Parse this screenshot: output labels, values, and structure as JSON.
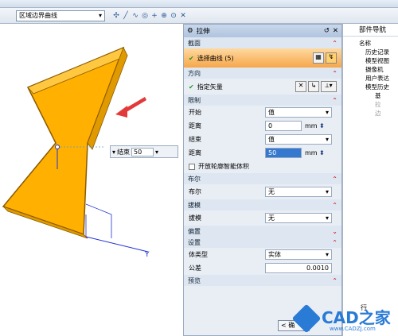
{
  "toolbar": {
    "filter_value": "区域边界曲线"
  },
  "viewport": {
    "float_end_label": "结束",
    "float_end_value": "50",
    "axis_y": "Y",
    "colors": {
      "shape": "#ffb000",
      "shape_edge": "#8a5a00",
      "arrow": "#e23a3a",
      "axis": "#2033d6"
    }
  },
  "dialog": {
    "title": "拉伸",
    "sections": {
      "section": "截面",
      "direction": "方向",
      "limits": "限制",
      "boolean": "布尔",
      "draft": "拔模",
      "offset": "偏置",
      "settings": "设置",
      "preview": "预览"
    },
    "select_curve": "选择曲线 (5)",
    "specify_vector": "指定矢量",
    "start_label": "开始",
    "start_type": "值",
    "start_dist_label": "距离",
    "start_dist_value": "0",
    "end_label": "结束",
    "end_type": "值",
    "end_dist_label": "距离",
    "end_dist_value": "50",
    "unit": "mm",
    "open_profile_label": "开放轮廓智能体积",
    "boolean_label": "布尔",
    "boolean_value": "无",
    "draft_label": "拔模",
    "draft_value": "无",
    "body_type_label": "体类型",
    "body_type_value": "实体",
    "tolerance_label": "公差",
    "tolerance_value": "0.0010",
    "ok_button": "< 确"
  },
  "navigator": {
    "title": "部件导航",
    "items": [
      "名称",
      "历史记录",
      "模型视图",
      "摄像机",
      "用户表达",
      "模型历史",
      "基",
      "拉",
      "边",
      "行"
    ]
  },
  "watermark": {
    "brand": "CAD之家",
    "url": "www.CADZJ.com"
  }
}
